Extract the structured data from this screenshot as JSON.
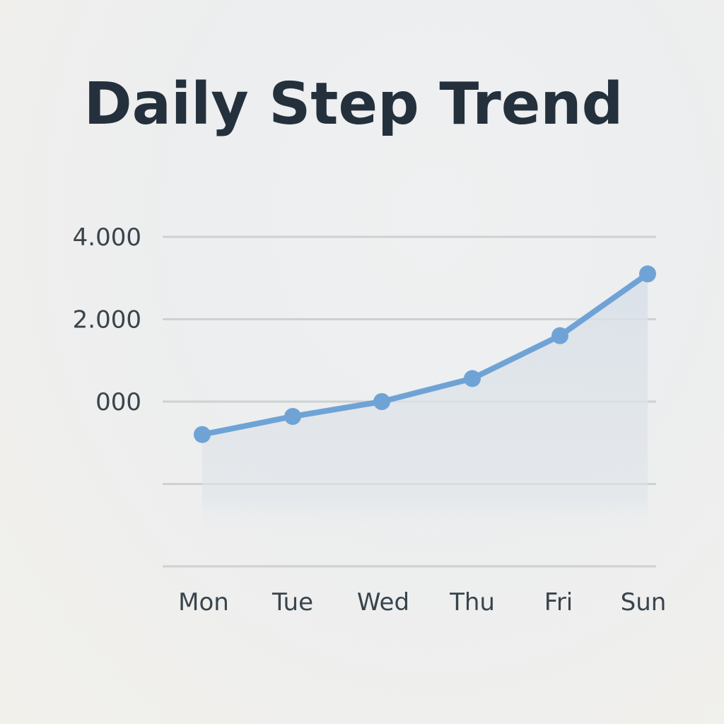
{
  "chart_data": {
    "type": "line",
    "title": "Daily Step Trend",
    "xlabel": "",
    "ylabel": "",
    "categories": [
      "Mon",
      "Tue",
      "Wed",
      "Thu",
      "Fri",
      "Sun"
    ],
    "y_tick_labels": [
      "4.000",
      "2.000",
      "000",
      "",
      ""
    ],
    "series": [
      {
        "values": [
          -800,
          -360,
          0,
          560,
          1600,
          3100
        ]
      }
    ],
    "ylim": [
      -4000,
      4000
    ],
    "grid": true,
    "area_fill": true,
    "colors": {
      "line": "#6fa3d6",
      "marker": "#6fa3d6",
      "area": "#d9e0e8",
      "grid": "#cdd1d3",
      "text": "#38444d",
      "title": "#24303c"
    }
  }
}
